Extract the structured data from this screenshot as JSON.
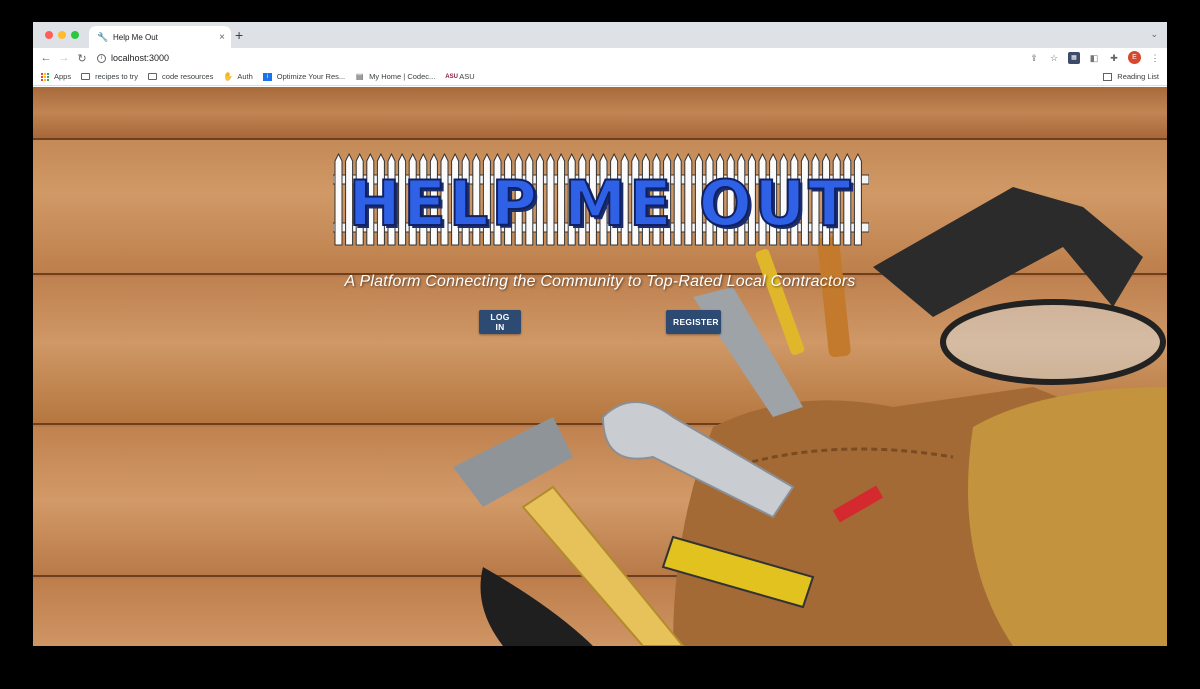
{
  "browser": {
    "tab_title": "Help Me Out",
    "tab_close": "×",
    "new_tab": "+",
    "tab_menu": "⌄",
    "url": "localhost:3000",
    "profile_initial": "E"
  },
  "bookmarks": [
    {
      "label": "Apps",
      "icon": "apps-grid-icon"
    },
    {
      "label": "recipes to try",
      "icon": "folder-icon"
    },
    {
      "label": "code resources",
      "icon": "folder-icon"
    },
    {
      "label": "Auth",
      "icon": "auth-icon"
    },
    {
      "label": "Optimize Your Res...",
      "icon": "info-bookmark-icon"
    },
    {
      "label": "My Home | Codec...",
      "icon": "document-icon"
    },
    {
      "label": "ASU",
      "icon": "asu-icon"
    }
  ],
  "reading_list": "Reading List",
  "hero": {
    "logo_text": "HELP ME OUT",
    "tagline": "A Platform Connecting the Community to Top-Rated Local Contractors",
    "login_label": "LOG IN",
    "register_label": "REGISTER"
  },
  "colors": {
    "wood": "#b87a4a",
    "logo_blue": "#2f61e6",
    "button_navy": "#2c4a72"
  }
}
